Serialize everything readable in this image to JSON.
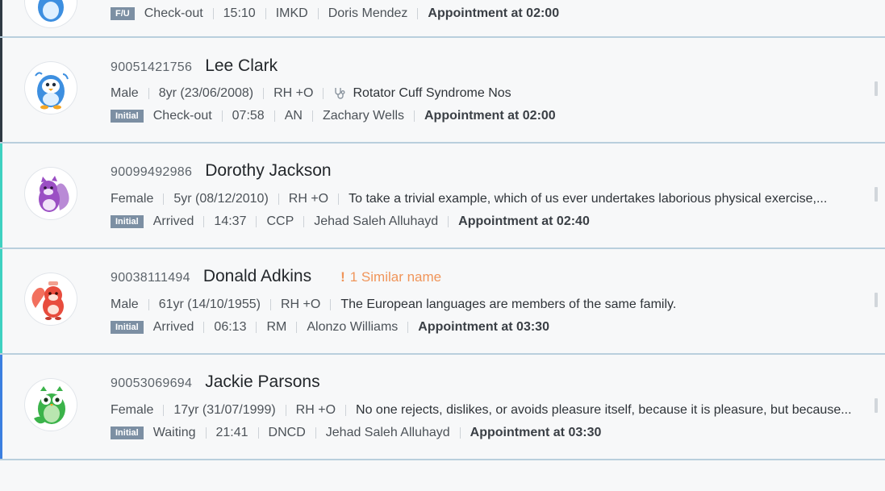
{
  "patients": [
    {
      "status": "Check-out",
      "time": "15:10",
      "dept": "IMKD",
      "doctor": "Doris Mendez",
      "visit_type": "F/U",
      "appointment": "Appointment at 02:00",
      "accent": "#2f3a44"
    },
    {
      "id": "90051421756",
      "name": "Lee Clark",
      "gender": "Male",
      "age": "8yr (23/06/2008)",
      "blood": "RH +O",
      "note_icon": "stethoscope-icon",
      "note": "Rotator Cuff Syndrome Nos",
      "visit_type": "Initial",
      "status": "Check-out",
      "time": "07:58",
      "dept": "AN",
      "doctor": "Zachary Wells",
      "appointment": "Appointment at 02:00",
      "avatar": "blue-penguin",
      "accent": "#2f3a44"
    },
    {
      "id": "90099492986",
      "name": "Dorothy Jackson",
      "gender": "Female",
      "age": "5yr (08/12/2010)",
      "blood": "RH +O",
      "note": "To take a trivial example, which of us ever undertakes laborious physical exercise,...",
      "visit_type": "Initial",
      "status": "Arrived",
      "time": "14:37",
      "dept": "CCP",
      "doctor": "Jehad Saleh Alluhayd",
      "appointment": "Appointment at 02:40",
      "avatar": "purple-squirrel",
      "accent": "#3fd1c1"
    },
    {
      "id": "90038111494",
      "name": "Donald Adkins",
      "warning": "1 Similar name",
      "gender": "Male",
      "age": "61yr (14/10/1955)",
      "blood": "RH +O",
      "note": "The European languages are members of the same family.",
      "visit_type": "Initial",
      "status": "Arrived",
      "time": "06:13",
      "dept": "RM",
      "doctor": "Alonzo Williams",
      "appointment": "Appointment at 03:30",
      "avatar": "red-squirrel",
      "accent": "#3fd1c1"
    },
    {
      "id": "90053069694",
      "name": "Jackie Parsons",
      "gender": "Female",
      "age": "17yr (31/07/1999)",
      "blood": "RH +O",
      "note": "No one rejects, dislikes, or avoids pleasure itself, because it is pleasure, but because...",
      "visit_type": "Initial",
      "status": "Waiting",
      "time": "21:41",
      "dept": "DNCD",
      "doctor": "Jehad Saleh Alluhayd",
      "appointment": "Appointment at 03:30",
      "avatar": "green-owl",
      "accent": "#3b7fe0"
    }
  ]
}
